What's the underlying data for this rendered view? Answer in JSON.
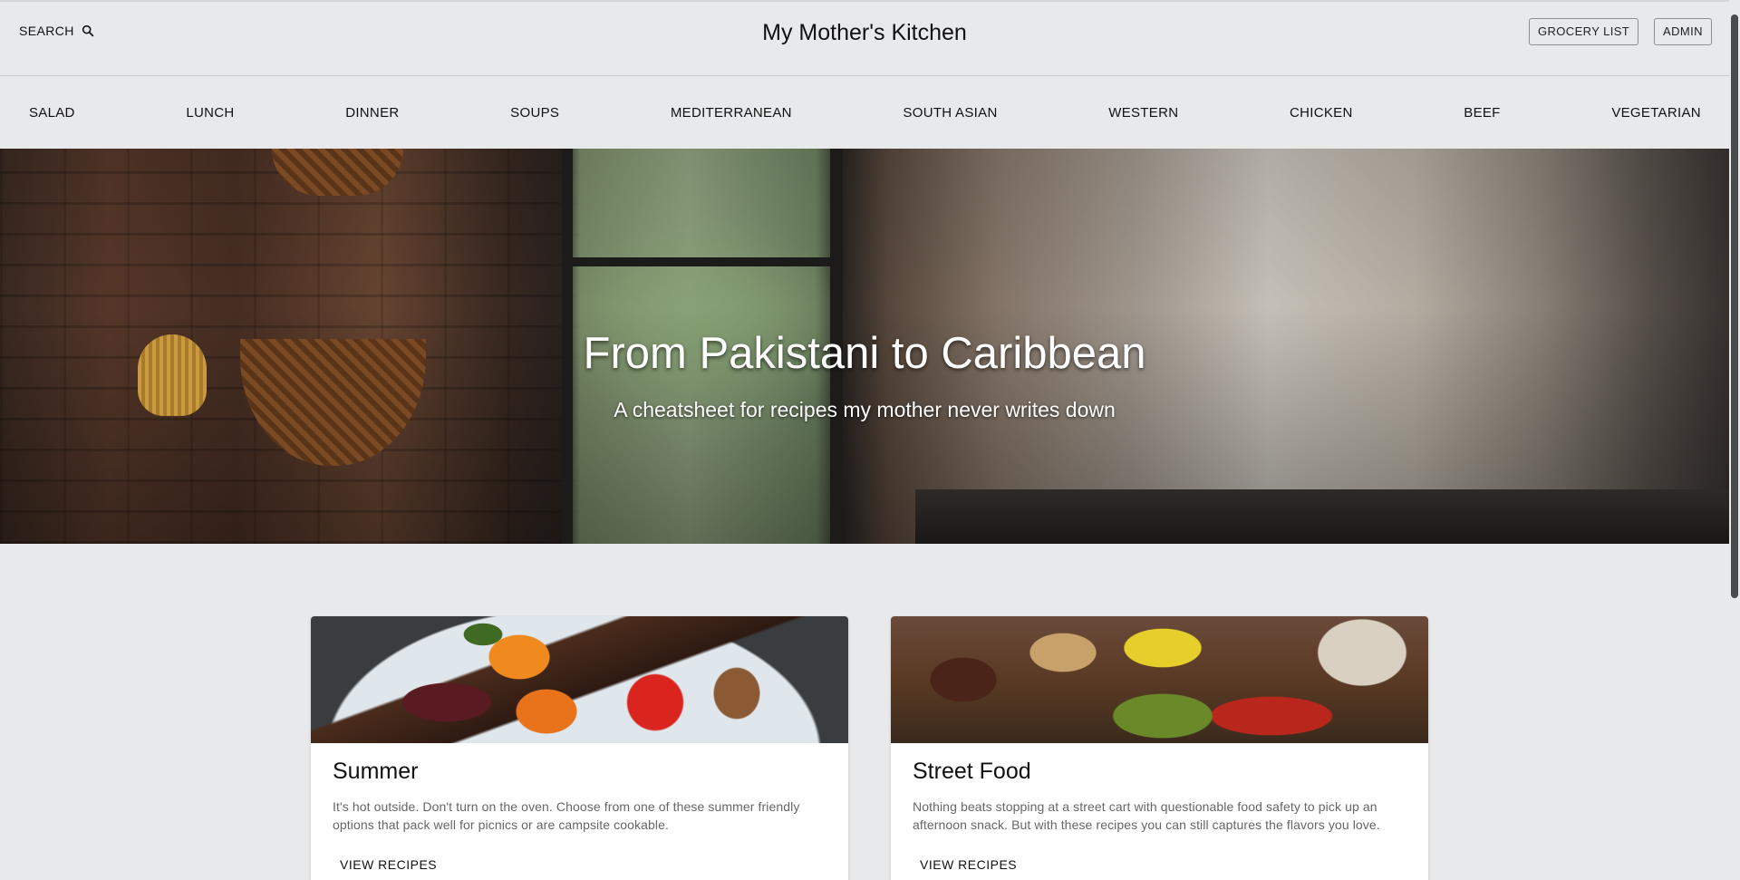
{
  "header": {
    "search_label": "SEARCH",
    "title": "My Mother's Kitchen",
    "grocery_label": "GROCERY LIST",
    "admin_label": "ADMIN"
  },
  "nav": {
    "items": [
      {
        "label": "SALAD"
      },
      {
        "label": "LUNCH"
      },
      {
        "label": "DINNER"
      },
      {
        "label": "SOUPS"
      },
      {
        "label": "MEDITERRANEAN"
      },
      {
        "label": "SOUTH ASIAN"
      },
      {
        "label": "WESTERN"
      },
      {
        "label": "CHICKEN"
      },
      {
        "label": "BEEF"
      },
      {
        "label": "VEGETARIAN"
      }
    ]
  },
  "hero": {
    "title": "From Pakistani to Caribbean",
    "subtitle": "A cheatsheet for recipes my mother never writes down"
  },
  "cards": [
    {
      "title": "Summer",
      "text": "It's hot outside. Don't turn on the oven. Choose from one of these summer friendly options that pack well for picnics or are campsite cookable.",
      "action": "VIEW RECIPES"
    },
    {
      "title": "Street Food",
      "text": "Nothing beats stopping at a street cart with questionable food safety to pick up an afternoon snack. But with these recipes you can still captures the flavors you love.",
      "action": "VIEW RECIPES"
    }
  ],
  "icons": {
    "search": "search-icon"
  }
}
